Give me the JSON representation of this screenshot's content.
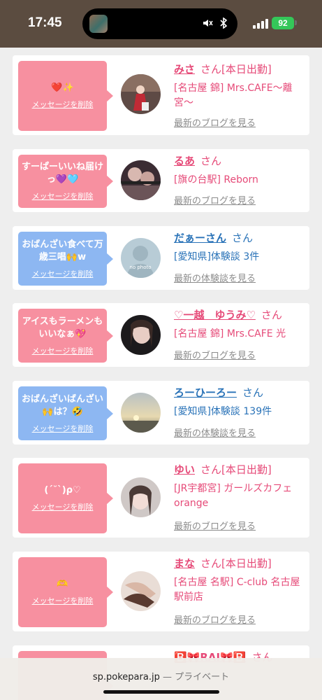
{
  "status_bar": {
    "time": "17:45",
    "battery": "92"
  },
  "messages": [
    {
      "color": "pink",
      "text": "❤️✨",
      "delete_label": "メッセージを削除",
      "name": "みさ",
      "san": "さん",
      "tag": "[本日出勤]",
      "detail": "[名古屋 錦] Mrs.CAFE〜離宮〜",
      "link": "最新のブログを見る",
      "avatar": "photo-red-dress"
    },
    {
      "color": "pink",
      "text": "すーぱーいいね届けっ💜🩵",
      "delete_label": "メッセージを削除",
      "name": "るあ",
      "san": "さん",
      "tag": "",
      "detail": "[旗の台駅] Reborn",
      "link": "最新のブログを見る",
      "avatar": "photo-couple"
    },
    {
      "color": "blue",
      "text": "おばんざい食べて万歳三唱🙌w",
      "delete_label": "メッセージを削除",
      "name": "だぁーさん",
      "san": "さん",
      "tag": "",
      "detail": "[愛知県]体験談 3件",
      "link": "最新の体験談を見る",
      "avatar": "no photo"
    },
    {
      "color": "pink",
      "text": "アイスもラーメンもいいなぁ💖",
      "delete_label": "メッセージを削除",
      "name": "♡一越　ゆうみ♡",
      "san": "さん",
      "tag": "",
      "detail": "[名古屋 錦] Mrs.CAFE 光",
      "link": "最新のブログを見る",
      "avatar": "photo-girl-dark"
    },
    {
      "color": "blue",
      "text": "おばんざいばんざい🙌は？🤣",
      "delete_label": "メッセージを削除",
      "name": "ろーひーろー",
      "san": "さん",
      "tag": "",
      "detail": "[愛知県]体験談 139件",
      "link": "最新の体験談を見る",
      "avatar": "photo-sunset"
    },
    {
      "color": "pink",
      "text": "(ˊ˘ˋ)ρ♡",
      "delete_label": "メッセージを削除",
      "name": "ゆい",
      "san": "さん",
      "tag": "[本日出勤]",
      "detail": "[JR宇都宮] ガールズカフェorange",
      "link": "最新のブログを見る",
      "avatar": "photo-girl-light"
    },
    {
      "color": "pink",
      "text": "🫶",
      "delete_label": "メッセージを削除",
      "name": "まな",
      "san": "さん",
      "tag": "[本日出勤]",
      "detail": "[名古屋 名駅] C-club 名古屋駅前店",
      "link": "最新のブログを見る",
      "avatar": "photo-hands"
    },
    {
      "color": "pink",
      "text": "",
      "delete_label": "",
      "name": "🅱️🎀RAI🎀🅱️",
      "san": "さん",
      "tag": "",
      "detail": "",
      "link": "",
      "avatar": ""
    }
  ],
  "url_bar": {
    "domain": "sp.pokepara.jp",
    "separator": " — ",
    "private": "プライベート"
  }
}
